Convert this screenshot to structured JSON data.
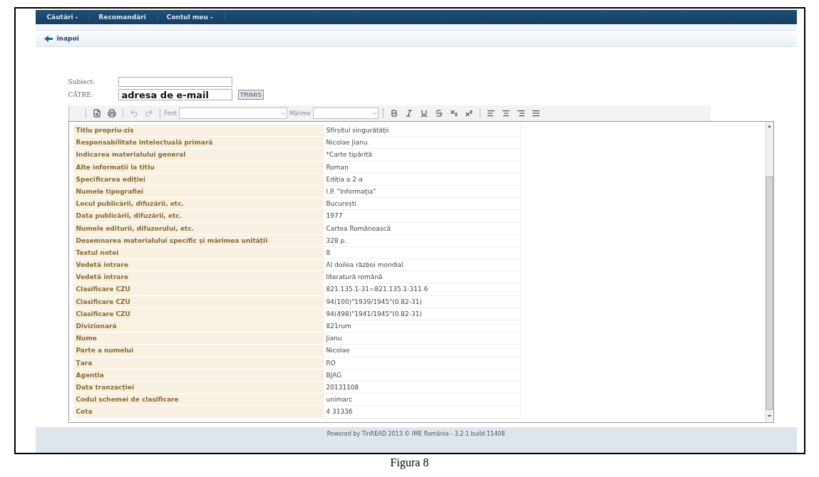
{
  "nav": {
    "items": [
      "Căutări -",
      "Recomandări",
      "Contul meu -"
    ]
  },
  "back_link": "înapoi",
  "form": {
    "subject_label": "Subiect:",
    "to_label": "CĂTRE:",
    "to_value": "adresa de e-mail",
    "send_button": "TRIMIS"
  },
  "toolbar": {
    "font_label": "Font",
    "size_label": "Mărime"
  },
  "table": {
    "rows": [
      {
        "label": "Titlu propriu-zis",
        "value": "Sfîrșitul singurătății"
      },
      {
        "label": "Responsabilitate intelectuală primară",
        "value": "Nicolae Jianu"
      },
      {
        "label": "Indicarea materialului general",
        "value": "*Carte tipărită"
      },
      {
        "label": "Alte informații la titlu",
        "value": "Roman"
      },
      {
        "label": "Specificarea ediției",
        "value": "Ediția a 2-a"
      },
      {
        "label": "Numele tipografiei",
        "value": "I.P. \"Informația\""
      },
      {
        "label": "Locul publicării, difuzării, etc.",
        "value": "București"
      },
      {
        "label": "Data publicării, difuzării, etc.",
        "value": "1977"
      },
      {
        "label": "Numele editurii, difuzorului, etc.",
        "value": "Cartea Românească"
      },
      {
        "label": "Desemnarea materialului specific și mărimea unității",
        "value": "328 p."
      },
      {
        "label": "Textul notei",
        "value": "8"
      },
      {
        "label": "Vedetă intrare",
        "value": "Al doilea război mondial"
      },
      {
        "label": "Vedetă intrare",
        "value": "literatură română"
      },
      {
        "label": "Clasificare CZU",
        "value": "821.135.1-31=821.135.1-311.6"
      },
      {
        "label": "Clasificare CZU",
        "value": "94(100)\"1939/1945\"(0.82-31)"
      },
      {
        "label": "Clasificare CZU",
        "value": "94(498)\"1941/1945\"(0.82-31)"
      },
      {
        "label": "Divizionară",
        "value": "821rum"
      },
      {
        "label": "Nume",
        "value": "Jianu"
      },
      {
        "label": "Parte a numelui",
        "value": "Nicolae"
      },
      {
        "label": "Țara",
        "value": "RO"
      },
      {
        "label": "Agenția",
        "value": "BJAG"
      },
      {
        "label": "Data tranzacției",
        "value": "20131108"
      },
      {
        "label": "Codul schemei de clasificare",
        "value": "unimarc"
      },
      {
        "label": "Cota",
        "value": "4 31336"
      }
    ]
  },
  "footer": "Powered by TinREAD 2013 © IME România - 3.2.1 build 11408",
  "caption": "Figura 8"
}
